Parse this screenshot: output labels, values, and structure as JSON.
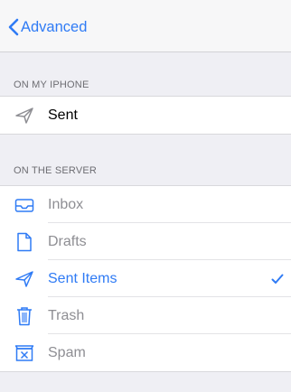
{
  "navbar": {
    "back_label": "Advanced"
  },
  "on_my_iphone": {
    "header": "ON MY IPHONE",
    "items": [
      {
        "label": "Sent",
        "icon": "paper-plane-icon"
      }
    ]
  },
  "on_the_server": {
    "header": "ON THE SERVER",
    "items": [
      {
        "label": "Inbox",
        "icon": "inbox-tray-icon",
        "state": "disabled"
      },
      {
        "label": "Drafts",
        "icon": "document-icon",
        "state": "disabled"
      },
      {
        "label": "Sent Items",
        "icon": "paper-plane-icon",
        "state": "selected"
      },
      {
        "label": "Trash",
        "icon": "trash-icon",
        "state": "disabled"
      },
      {
        "label": "Spam",
        "icon": "junk-box-icon",
        "state": "disabled"
      }
    ]
  },
  "colors": {
    "accent": "#2f7bf5",
    "disabled_text": "#8e8e93",
    "header_text": "#6d6d72",
    "background": "#efeff4"
  }
}
